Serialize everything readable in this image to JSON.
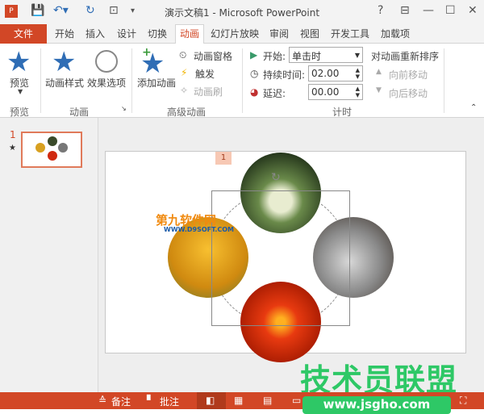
{
  "titlebar": {
    "title": "演示文稿1 - Microsoft PowerPoint",
    "app_icon": "powerpoint-icon",
    "help": "?",
    "controls": [
      "ribbon-display-icon",
      "minimize-icon",
      "maximize-icon",
      "close-icon"
    ]
  },
  "tabs": {
    "file": "文件",
    "items": [
      "开始",
      "插入",
      "设计",
      "切换",
      "动画",
      "幻灯片放映",
      "审阅",
      "视图",
      "开发工具",
      "加载项"
    ],
    "active": "动画"
  },
  "ribbon": {
    "preview": {
      "label": "预览",
      "group": "预览"
    },
    "animation": {
      "style": "动画样式",
      "effects": "效果选项",
      "group": "动画"
    },
    "advanced": {
      "add": "添加动画",
      "pane": "动画窗格",
      "trigger": "触发",
      "painter": "动画刷",
      "group": "高级动画"
    },
    "timing": {
      "start_label": "开始:",
      "start_value": "单击时",
      "duration_label": "持续时间:",
      "duration_value": "02.00",
      "delay_label": "延迟:",
      "delay_value": "00.00",
      "group": "计时"
    },
    "reorder": {
      "title": "对动画重新排序",
      "forward": "向前移动",
      "backward": "向后移动"
    }
  },
  "thumbnail": {
    "number": "1",
    "star": "★"
  },
  "slide": {
    "anim_tag": "1",
    "watermark1_top": "第九软件网",
    "watermark1_bottom": "WWW.D9SOFT.COM"
  },
  "watermark": {
    "text": "技术员联盟",
    "url": "www.jsgho.com",
    "color": "#2ec866"
  },
  "status": {
    "notes": "备注",
    "comments": "批注"
  },
  "colors": {
    "accent": "#d24726",
    "star": "#2f6db5"
  }
}
